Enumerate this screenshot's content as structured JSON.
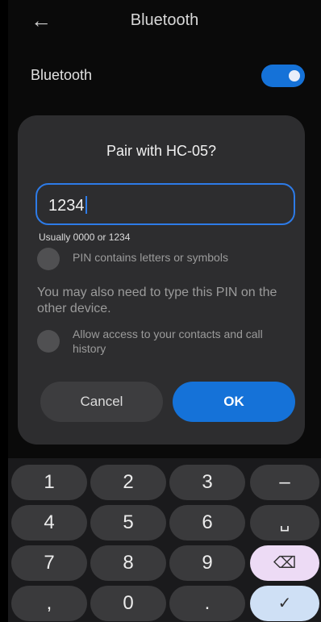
{
  "header": {
    "back_icon": "arrow-left-icon",
    "title": "Bluetooth"
  },
  "bluetooth_row": {
    "label": "Bluetooth",
    "enabled": true
  },
  "dialog": {
    "title": "Pair with HC-05?",
    "pin_value": "1234",
    "hint": "Usually 0000 or 1234",
    "pin_option_label": "PIN contains letters or symbols",
    "note": "You may also need to type this PIN on the other device.",
    "contacts_option_label": "Allow access to your contacts and call history",
    "cancel_label": "Cancel",
    "ok_label": "OK"
  },
  "keyboard": {
    "keys": [
      "1",
      "2",
      "3",
      "–",
      "4",
      "5",
      "6",
      "␣",
      "7",
      "8",
      "9",
      "⌫",
      ",",
      "0",
      ".",
      "✓"
    ]
  },
  "colors": {
    "accent": "#1572d8",
    "dialog_bg": "#2d2d2f",
    "key_bg": "#3a3a3c"
  }
}
